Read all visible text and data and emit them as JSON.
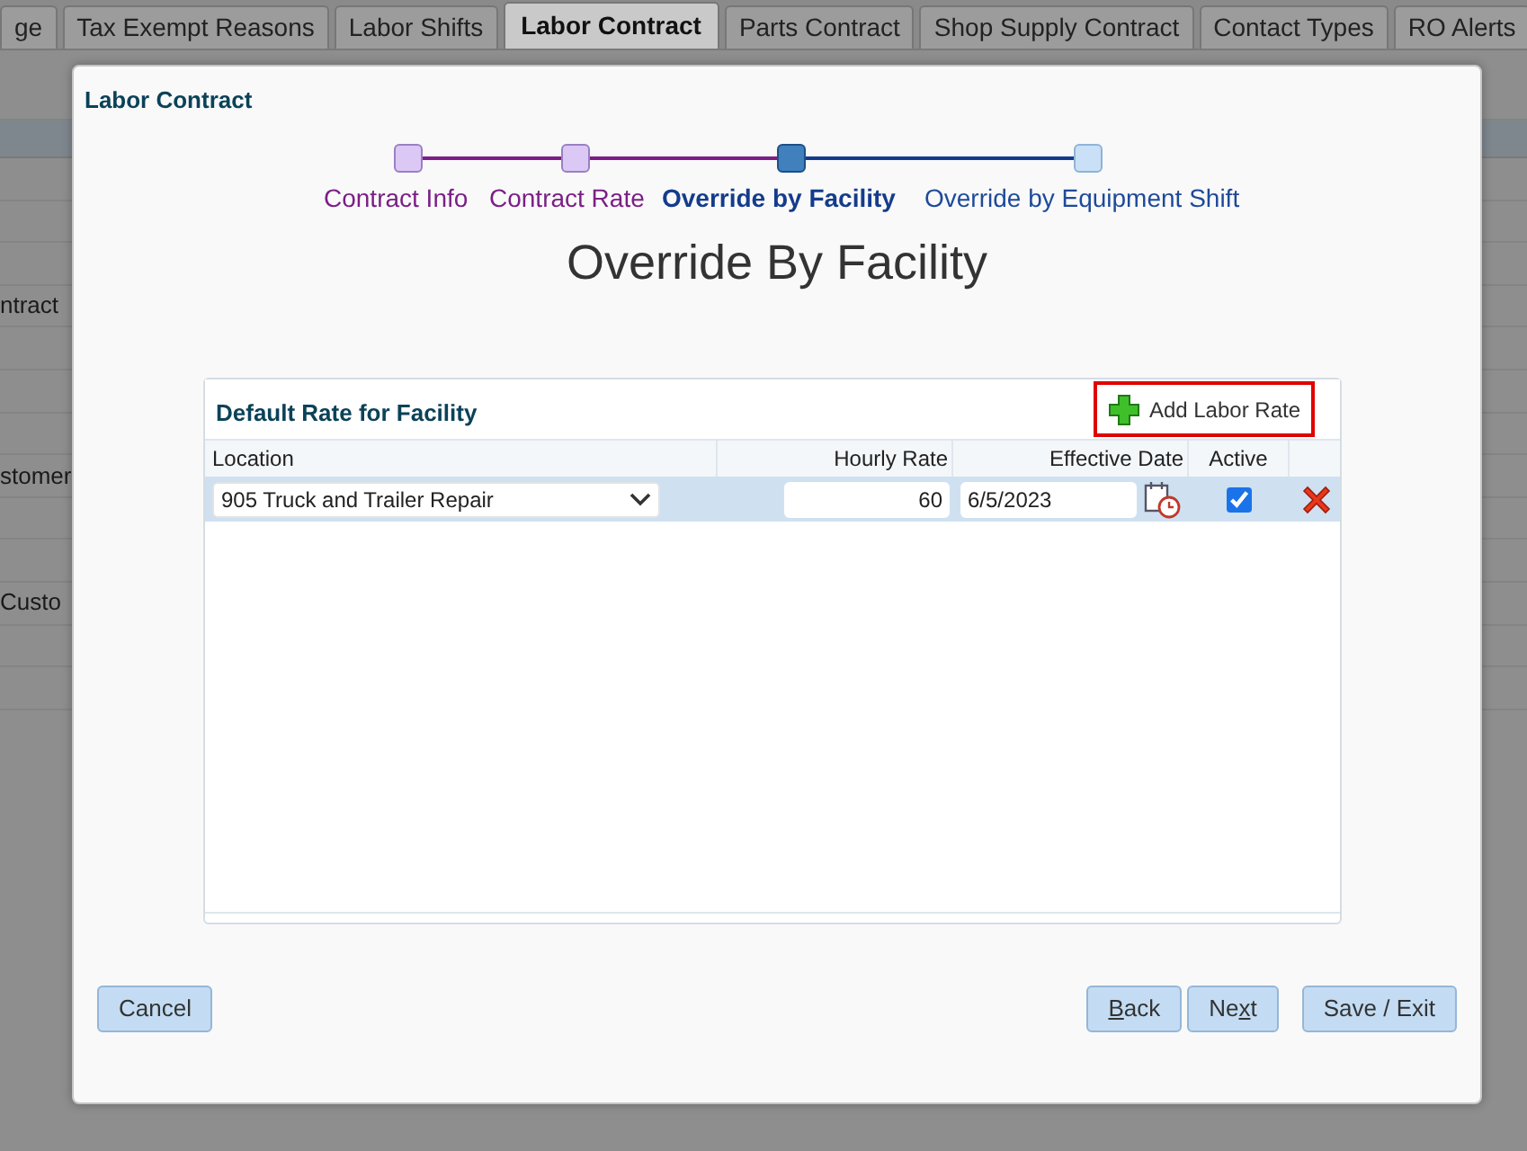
{
  "tabs": [
    {
      "label": "ge",
      "selected": false
    },
    {
      "label": "Tax Exempt Reasons",
      "selected": false
    },
    {
      "label": "Labor Shifts",
      "selected": false
    },
    {
      "label": "Labor Contract",
      "selected": true
    },
    {
      "label": "Parts Contract",
      "selected": false
    },
    {
      "label": "Shop Supply Contract",
      "selected": false
    },
    {
      "label": "Contact Types",
      "selected": false
    },
    {
      "label": "RO Alerts",
      "selected": false
    }
  ],
  "background_rows": [
    "",
    "",
    "",
    "ntract",
    "",
    "",
    "",
    "stomer",
    "",
    "",
    "Custo",
    "",
    ""
  ],
  "dialog": {
    "title": "Labor Contract",
    "steps": [
      {
        "label": "Contract Info",
        "completed": true,
        "selected": false
      },
      {
        "label": "Contract Rate",
        "completed": true,
        "selected": false
      },
      {
        "label": "Override by Facility",
        "completed": false,
        "selected": true
      },
      {
        "label": "Override by Equipment Shift",
        "completed": false,
        "selected": false
      }
    ],
    "heading": "Override By Facility",
    "panel": {
      "title": "Default Rate for Facility",
      "add_button": "Add Labor Rate",
      "columns": [
        "Location",
        "Hourly Rate",
        "Effective Date",
        "Active"
      ],
      "rows": [
        {
          "location": "905 Truck and Trailer Repair",
          "hourly_rate": "60",
          "effective_date": "6/5/2023",
          "active": true
        }
      ]
    },
    "buttons": [
      {
        "kind": "left",
        "before": "Cancel"
      },
      {
        "kind": "right",
        "mnemonic": "B",
        "after": "ack"
      },
      {
        "kind": "right",
        "before": "Ne",
        "mnemonic": "x",
        "after": "t"
      },
      {
        "kind": "right_gap",
        "before": "Save / Exit"
      }
    ]
  }
}
